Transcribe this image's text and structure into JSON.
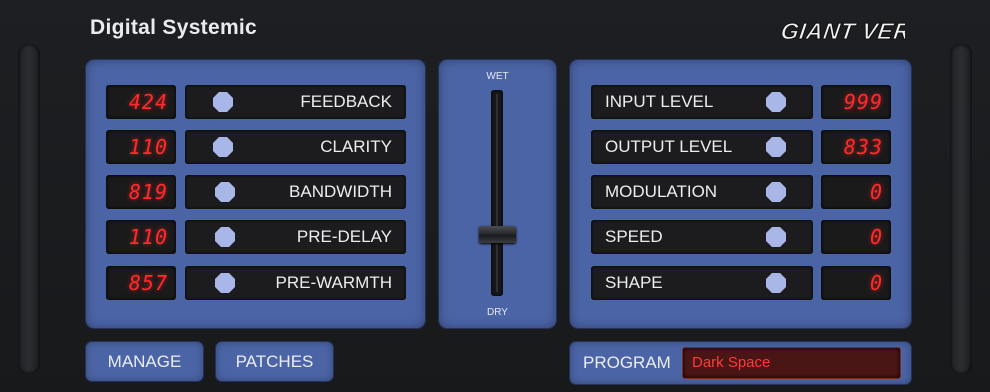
{
  "header": {
    "brand": "Digital Systemic",
    "logo": "GIANT VERB"
  },
  "left_panel": {
    "rows": [
      {
        "value": "424",
        "label": "FEEDBACK"
      },
      {
        "value": "110",
        "label": "CLARITY"
      },
      {
        "value": "819",
        "label": "BANDWIDTH"
      },
      {
        "value": "110",
        "label": "PRE-DELAY"
      },
      {
        "value": "857",
        "label": "PRE-WARMTH"
      }
    ]
  },
  "fader": {
    "top_label": "WET",
    "bottom_label": "DRY",
    "position": 0.72
  },
  "right_panel": {
    "rows": [
      {
        "label": "INPUT LEVEL",
        "value": "999"
      },
      {
        "label": "OUTPUT LEVEL",
        "value": "833"
      },
      {
        "label": "MODULATION",
        "value": "0"
      },
      {
        "label": "SPEED",
        "value": "0"
      },
      {
        "label": "SHAPE",
        "value": "0"
      }
    ]
  },
  "buttons": {
    "manage": "MANAGE",
    "patches": "PATCHES"
  },
  "program": {
    "label": "PROGRAM",
    "value": "Dark Space"
  },
  "colors": {
    "panel": "#4b64a6",
    "lcd_text": "#ff2a2a",
    "knob": "#a9b7e8",
    "background": "#1d1f22"
  }
}
